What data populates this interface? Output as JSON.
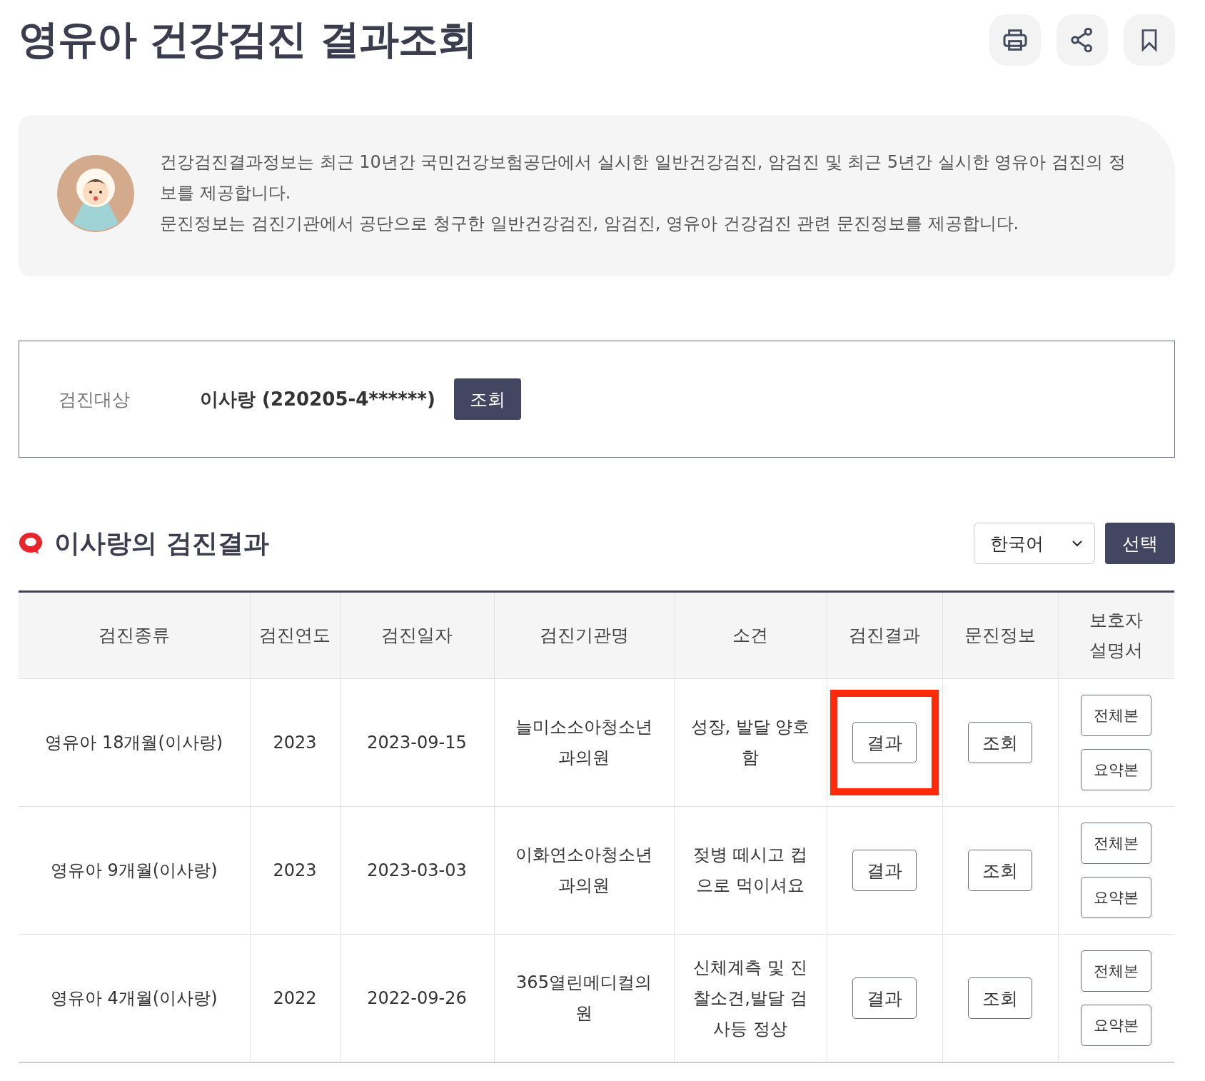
{
  "title": "영유아 건강검진 결과조회",
  "toolbar": [
    {
      "kind": "print"
    },
    {
      "kind": "share"
    },
    {
      "kind": "bookmark"
    }
  ],
  "notice": {
    "paragraphs": [
      "건강검진결과정보는 최근 10년간 국민건강보험공단에서 실시한 일반건강검진, 암검진 및 최근 5년간 실시한 영유아 검진의 정보를 제공합니다.",
      "문진정보는 검진기관에서 공단으로 청구한 일반건강검진, 암검진, 영유아 건강검진 관련 문진정보를 제공합니다."
    ]
  },
  "target": {
    "label": "검진대상",
    "value": "이사랑 (220205-4******)",
    "button": "조회"
  },
  "section": {
    "title": "이사랑의 검진결과",
    "language_select": {
      "value": "한국어"
    },
    "button": "선택"
  },
  "table": {
    "columns": [
      "검진종류",
      "검진연도",
      "검진일자",
      "검진기관명",
      "소견",
      "검진결과",
      "문진정보",
      "보호자 설명서"
    ],
    "rows": [
      {
        "type": "영유아 18개월(이사랑)",
        "year": "2023",
        "date": "2023-09-15",
        "clinic": "늘미소소아청소년과의원",
        "opinion": "성장, 발달 양호함",
        "result_button": "결과",
        "survey_button": "조회",
        "guide_buttons": [
          "전체본",
          "요약본"
        ],
        "highlighted": true
      },
      {
        "type": "영유아 9개월(이사랑)",
        "year": "2023",
        "date": "2023-03-03",
        "clinic": "이화연소아청소년과의원",
        "opinion": "젖병 떼시고 컵으로 먹이셔요",
        "result_button": "결과",
        "survey_button": "조회",
        "guide_buttons": [
          "전체본",
          "요약본"
        ],
        "highlighted": false
      },
      {
        "type": "영유아 4개월(이사랑)",
        "year": "2022",
        "date": "2022-09-26",
        "clinic": "365열린메디컬의원",
        "opinion": "신체계측 및 진찰소견,발달 검사등 정상",
        "result_button": "결과",
        "survey_button": "조회",
        "guide_buttons": [
          "전체본",
          "요약본"
        ],
        "highlighted": false
      }
    ]
  }
}
